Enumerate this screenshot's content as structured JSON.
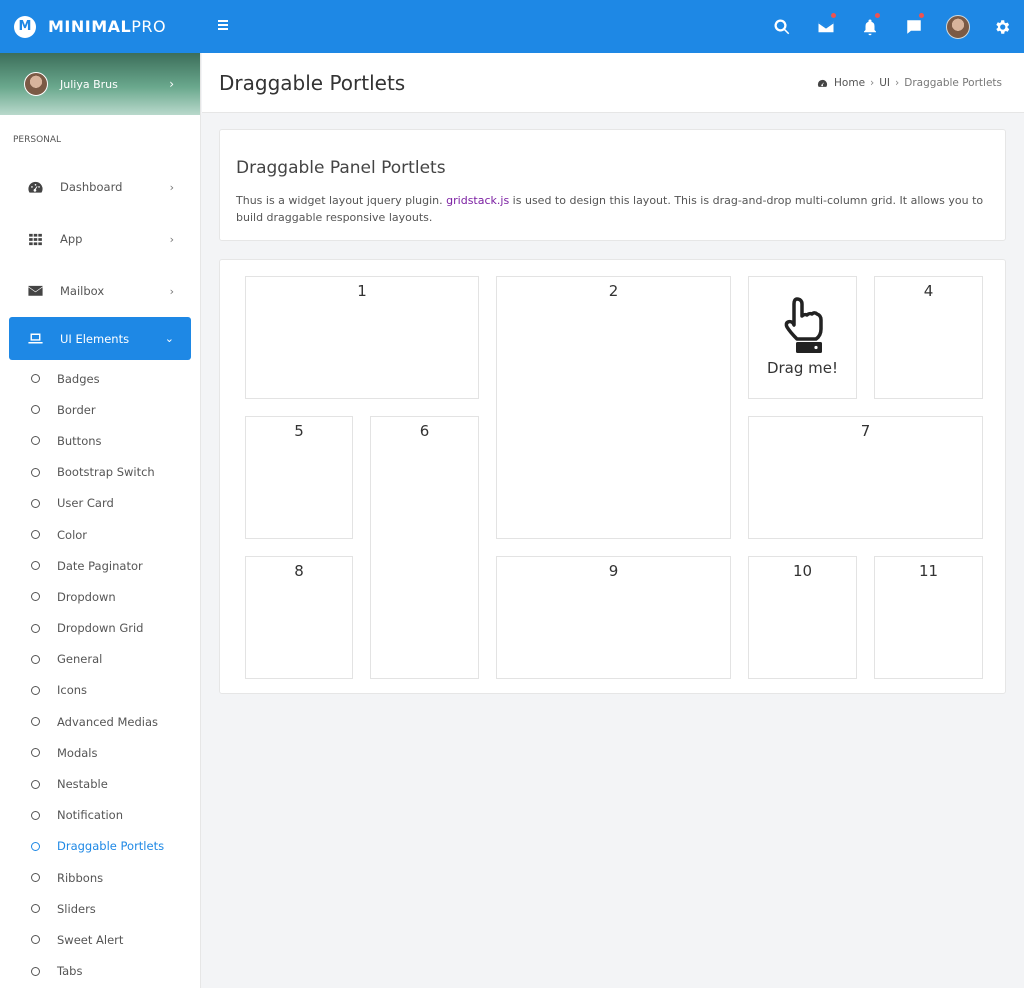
{
  "brand": {
    "name_bold": "MINIMAL",
    "name_light": "PRO",
    "mark": "M"
  },
  "topbar": {
    "icons": [
      "search-icon",
      "mail-icon",
      "bell-icon",
      "chat-icon",
      "avatar",
      "gear-icon"
    ],
    "accent": "#1e88e5",
    "notification_dot_color": "#ef5350"
  },
  "sidebar": {
    "user": {
      "name": "Juliya Brus"
    },
    "section_label": "PERSONAL",
    "items": [
      {
        "label": "Dashboard",
        "icon": "dashboard-icon"
      },
      {
        "label": "App",
        "icon": "grid-icon"
      },
      {
        "label": "Mailbox",
        "icon": "envelope-icon"
      },
      {
        "label": "UI Elements",
        "icon": "laptop-icon"
      }
    ],
    "submenu": [
      "Badges",
      "Border",
      "Buttons",
      "Bootstrap Switch",
      "User Card",
      "Color",
      "Date Paginator",
      "Dropdown",
      "Dropdown Grid",
      "General",
      "Icons",
      "Advanced Medias",
      "Modals",
      "Nestable",
      "Notification",
      "Draggable Portlets",
      "Ribbons",
      "Sliders",
      "Sweet Alert",
      "Tabs"
    ],
    "current_sub": "Draggable Portlets"
  },
  "page": {
    "title": "Draggable Portlets",
    "breadcrumb": {
      "home": "Home",
      "section": "UI",
      "current": "Draggable Portlets"
    }
  },
  "info": {
    "title": "Draggable Panel Portlets",
    "desc_before": "Thus is a widget layout jquery plugin. ",
    "desc_link": "gridstack.js",
    "desc_after": " is used to design this layout. This is drag-and-drop multi-column grid. It allows you to build draggable responsive layouts."
  },
  "portlets": {
    "p1": "1",
    "p2": "2",
    "p4": "4",
    "p5": "5",
    "p6": "6",
    "p7": "7",
    "p8": "8",
    "p9": "9",
    "p10": "10",
    "p11": "11",
    "drag_label": "Drag me!"
  }
}
